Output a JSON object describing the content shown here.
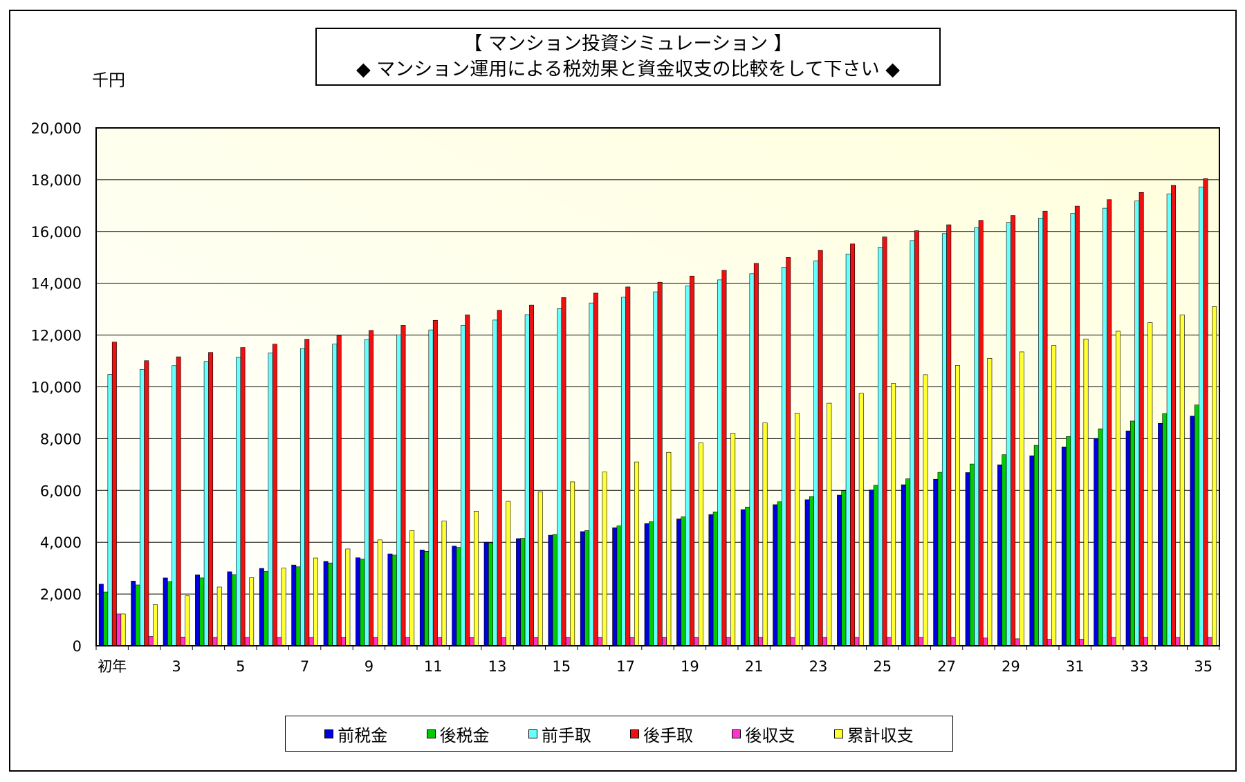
{
  "title": {
    "line1": "【 マンション投資シミュレーション 】",
    "line2": "◆ マンション運用による税効果と資金収支の比較をして下さい ◆"
  },
  "unit_label": "千円",
  "chart_data": {
    "type": "bar",
    "title": "【 マンション投資シミュレーション 】",
    "subtitle": "◆ マンション運用による税効果と資金収支の比較をして下さい ◆",
    "ylabel": "千円",
    "ylim": [
      0,
      20000
    ],
    "yticks": [
      0,
      2000,
      4000,
      6000,
      8000,
      10000,
      12000,
      14000,
      16000,
      18000,
      20000
    ],
    "ytick_labels": [
      "0",
      "2,000",
      "4,000",
      "6,000",
      "8,000",
      "10,000",
      "12,000",
      "14,000",
      "16,000",
      "18,000",
      "20,000"
    ],
    "grid": true,
    "legend_position": "bottom",
    "categories": [
      "初年",
      "2",
      "3",
      "4",
      "5",
      "6",
      "7",
      "8",
      "9",
      "10",
      "11",
      "12",
      "13",
      "14",
      "15",
      "16",
      "17",
      "18",
      "19",
      "20",
      "21",
      "22",
      "23",
      "24",
      "25",
      "26",
      "27",
      "28",
      "29",
      "30",
      "31",
      "32",
      "33",
      "34",
      "35"
    ],
    "xtick_labels": [
      "初年",
      "",
      "3",
      "",
      "5",
      "",
      "7",
      "",
      "9",
      "",
      "11",
      "",
      "13",
      "",
      "15",
      "",
      "17",
      "",
      "19",
      "",
      "21",
      "",
      "23",
      "",
      "25",
      "",
      "27",
      "",
      "29",
      "",
      "31",
      "",
      "33",
      "",
      "35"
    ],
    "series": [
      {
        "name": "前税金",
        "color": "#0000dd",
        "values": [
          2380,
          2500,
          2620,
          2740,
          2860,
          2990,
          3120,
          3260,
          3400,
          3550,
          3700,
          3850,
          4000,
          4140,
          4270,
          4410,
          4560,
          4720,
          4900,
          5070,
          5260,
          5450,
          5640,
          5820,
          6020,
          6220,
          6430,
          6690,
          6990,
          7340,
          7680,
          8010,
          8300,
          8590,
          8870
        ]
      },
      {
        "name": "後税金",
        "color": "#00cc00",
        "values": [
          2080,
          2350,
          2480,
          2620,
          2750,
          2870,
          3050,
          3200,
          3350,
          3500,
          3650,
          3800,
          3980,
          4150,
          4300,
          4450,
          4630,
          4790,
          4980,
          5170,
          5360,
          5560,
          5760,
          5990,
          6200,
          6450,
          6700,
          7020,
          7380,
          7740,
          8080,
          8380,
          8680,
          8970,
          9300
        ]
      },
      {
        "name": "前手取",
        "color": "#66ffff",
        "values": [
          10480,
          10670,
          10820,
          10980,
          11150,
          11310,
          11480,
          11650,
          11830,
          12010,
          12200,
          12380,
          12580,
          12790,
          13020,
          13240,
          13460,
          13670,
          13900,
          14130,
          14370,
          14620,
          14870,
          15130,
          15390,
          15650,
          15920,
          16150,
          16350,
          16520,
          16700,
          16900,
          17180,
          17450,
          17720
        ]
      },
      {
        "name": "後手取",
        "color": "#ee1111",
        "values": [
          11730,
          11010,
          11160,
          11330,
          11520,
          11650,
          11840,
          11990,
          12180,
          12380,
          12570,
          12780,
          12960,
          13160,
          13450,
          13620,
          13860,
          14040,
          14280,
          14500,
          14770,
          15000,
          15270,
          15520,
          15790,
          16030,
          16260,
          16430,
          16620,
          16790,
          16980,
          17230,
          17510,
          17780,
          18040
        ]
      },
      {
        "name": "後収支",
        "color": "#ff33cc",
        "values": [
          1230,
          360,
          340,
          330,
          330,
          330,
          330,
          330,
          330,
          330,
          330,
          330,
          330,
          330,
          330,
          330,
          330,
          330,
          330,
          330,
          330,
          330,
          330,
          330,
          330,
          330,
          330,
          300,
          270,
          250,
          250,
          330,
          330,
          330,
          330
        ]
      },
      {
        "name": "累計収支",
        "color": "#ffff33",
        "values": [
          1230,
          1590,
          1930,
          2270,
          2630,
          3000,
          3390,
          3740,
          4090,
          4450,
          4820,
          5200,
          5580,
          5950,
          6330,
          6710,
          7100,
          7470,
          7840,
          8210,
          8610,
          8990,
          9370,
          9750,
          10130,
          10470,
          10830,
          11100,
          11350,
          11600,
          11850,
          12150,
          12480,
          12780,
          13100
        ]
      }
    ]
  }
}
